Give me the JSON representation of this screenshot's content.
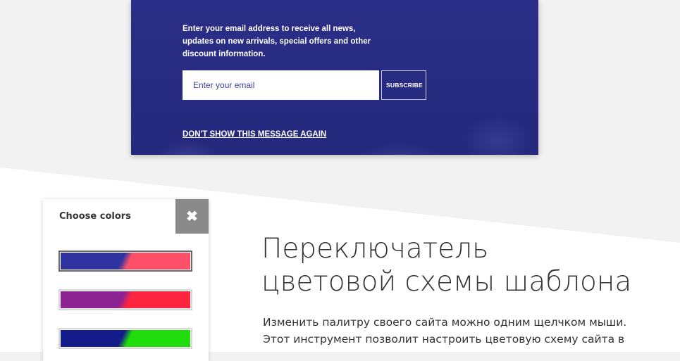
{
  "newsletter": {
    "text": "Enter your email address to receive all news, updates on new arrivals, special offers and other discount information.",
    "email_placeholder": "Enter your email",
    "subscribe_label": "SUBSCRIBE",
    "dont_show_label": "DON'T SHOW THIS MESSAGE AGAIN",
    "colors": {
      "background": "#2a2e86"
    }
  },
  "color_panel": {
    "title": "Choose colors",
    "close_icon": "close-icon",
    "close_glyph": "✖",
    "schemes": [
      {
        "primary": "#2e33a0",
        "secondary": "#fd5068",
        "selected": true
      },
      {
        "primary": "#8d2393",
        "secondary": "#fd2440",
        "selected": false
      },
      {
        "primary": "#141c89",
        "secondary": "#22dd0c",
        "selected": false
      }
    ]
  },
  "feature": {
    "heading_line1": "Переключатель",
    "heading_line2": "цветовой схемы шаблона",
    "description_line1": "Изменить палитру своего сайта можно одним щелчком мыши.",
    "description_line2": "Этот инструмент позволит настроить цветовую схему сайта в"
  }
}
